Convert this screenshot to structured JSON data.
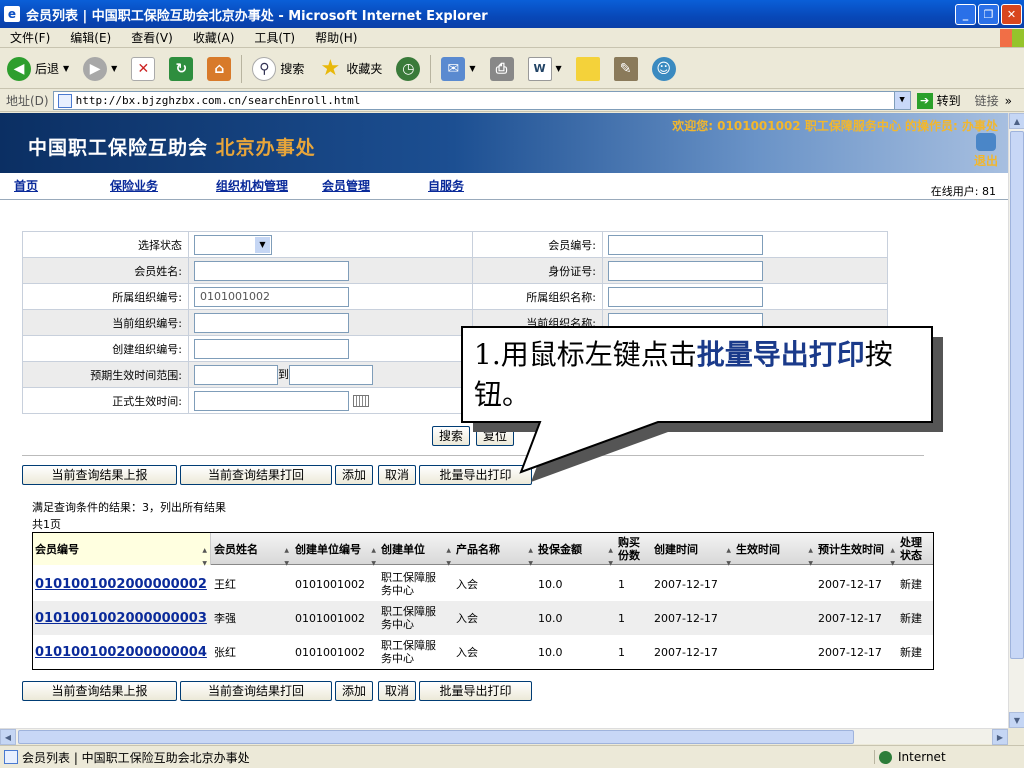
{
  "window": {
    "title": "会员列表 | 中国职工保险互助会北京办事处 - Microsoft Internet Explorer",
    "icon": "ie-icon",
    "controls": [
      "_",
      "❐",
      "✕"
    ]
  },
  "menubar": [
    "文件(F)",
    "编辑(E)",
    "查看(V)",
    "收藏(A)",
    "工具(T)",
    "帮助(H)"
  ],
  "toolbar": {
    "back_label": "后退",
    "search_label": "搜索",
    "favorites_label": "收藏夹"
  },
  "addressbar": {
    "label": "地址(D)",
    "url": "http://bx.bjzghzbx.com.cn/searchEnroll.html",
    "go_label": "转到",
    "links_label": "链接"
  },
  "banner": {
    "logo_main": "中国职工保险互助会",
    "logo_sub": "北京办事处",
    "welcome": "欢迎您: 0101001002 职工保障服务中心 的操作员: 办事处",
    "logout": "退出"
  },
  "nav": {
    "items": [
      "首页",
      "保险业务",
      "组织机构管理",
      "会员管理",
      "自服务"
    ],
    "online_users": "在线用户: 81"
  },
  "form": {
    "rows": [
      {
        "l1": "选择状态",
        "v1": "",
        "l2": "会员编号:",
        "v2": ""
      },
      {
        "l1": "会员姓名:",
        "v1": "",
        "l2": "身份证号:",
        "v2": ""
      },
      {
        "l1": "所属组织编号:",
        "v1": "0101001002",
        "l2": "所属组织名称:",
        "v2": ""
      },
      {
        "l1": "当前组织编号:",
        "v1": "",
        "l2": "当前组织名称:",
        "v2": ""
      },
      {
        "l1": "创建组织编号:",
        "v1": ""
      },
      {
        "l1": "预期生效时间范围:",
        "v1": "",
        "range_sep": "到",
        "v1b": ""
      },
      {
        "l1": "正式生效时间:",
        "v1": ""
      }
    ],
    "search_label": "搜索",
    "reset_label": "复位"
  },
  "actions": {
    "report": "当前查询结果上报",
    "print": "当前查询结果打回",
    "add": "添加",
    "cancel": "取消",
    "batch_export": "批量导出打印"
  },
  "results": {
    "summary": "满足查询条件的结果：3，列出所有结果",
    "pages": "共1页",
    "columns": [
      "会员编号",
      "会员姓名",
      "创建单位编号",
      "创建单位",
      "产品名称",
      "投保金额",
      "购买份数",
      "创建时间",
      "生效时间",
      "预计生效时间",
      "处理状态"
    ],
    "rows": [
      [
        "0101001002000000002",
        "王红",
        "0101001002",
        "职工保障服务中心",
        "入会",
        "10.0",
        "1",
        "2007-12-17",
        "",
        "2007-12-17",
        "新建"
      ],
      [
        "0101001002000000003",
        "李强",
        "0101001002",
        "职工保障服务中心",
        "入会",
        "10.0",
        "1",
        "2007-12-17",
        "",
        "2007-12-17",
        "新建"
      ],
      [
        "0101001002000000004",
        "张红",
        "0101001002",
        "职工保障服务中心",
        "入会",
        "10.0",
        "1",
        "2007-12-17",
        "",
        "2007-12-17",
        "新建"
      ]
    ]
  },
  "callout": {
    "prefix": "1.用鼠标左键点击",
    "highlight": "批量导出打印",
    "suffix": "按钮。"
  },
  "statusbar": {
    "text": "会员列表 | 中国职工保险互助会北京办事处",
    "zone": "Internet"
  }
}
